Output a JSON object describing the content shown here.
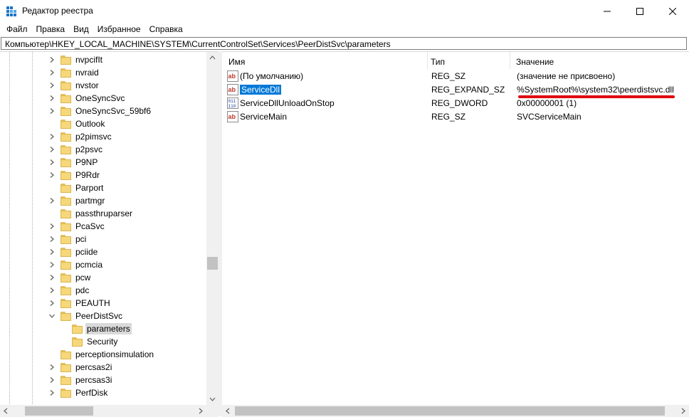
{
  "window": {
    "title": "Редактор реестра",
    "icon": "regedit-icon",
    "controls": [
      "minimize",
      "maximize",
      "close"
    ]
  },
  "menu": [
    "Файл",
    "Правка",
    "Вид",
    "Избранное",
    "Справка"
  ],
  "address": "Компьютер\\HKEY_LOCAL_MACHINE\\SYSTEM\\CurrentControlSet\\Services\\PeerDistSvc\\parameters",
  "tree": {
    "items": [
      {
        "label": "nvpcifIt",
        "arrow": "right",
        "level": 0
      },
      {
        "label": "nvraid",
        "arrow": "right",
        "level": 0
      },
      {
        "label": "nvstor",
        "arrow": "right",
        "level": 0
      },
      {
        "label": "OneSyncSvc",
        "arrow": "right",
        "level": 0
      },
      {
        "label": "OneSyncSvc_59bf6",
        "arrow": "right",
        "level": 0
      },
      {
        "label": "Outlook",
        "arrow": "none",
        "level": 0
      },
      {
        "label": "p2pimsvc",
        "arrow": "right",
        "level": 0
      },
      {
        "label": "p2psvc",
        "arrow": "right",
        "level": 0
      },
      {
        "label": "P9NP",
        "arrow": "right",
        "level": 0
      },
      {
        "label": "P9Rdr",
        "arrow": "right",
        "level": 0
      },
      {
        "label": "Parport",
        "arrow": "none",
        "level": 0
      },
      {
        "label": "partmgr",
        "arrow": "right",
        "level": 0
      },
      {
        "label": "passthruparser",
        "arrow": "none",
        "level": 0
      },
      {
        "label": "PcaSvc",
        "arrow": "right",
        "level": 0
      },
      {
        "label": "pci",
        "arrow": "right",
        "level": 0
      },
      {
        "label": "pciide",
        "arrow": "right",
        "level": 0
      },
      {
        "label": "pcmcia",
        "arrow": "right",
        "level": 0
      },
      {
        "label": "pcw",
        "arrow": "right",
        "level": 0
      },
      {
        "label": "pdc",
        "arrow": "right",
        "level": 0
      },
      {
        "label": "PEAUTH",
        "arrow": "right",
        "level": 0
      },
      {
        "label": "PeerDistSvc",
        "arrow": "down",
        "level": 0
      },
      {
        "label": "parameters",
        "arrow": "none",
        "level": 1,
        "selected": true
      },
      {
        "label": "Security",
        "arrow": "none",
        "level": 1
      },
      {
        "label": "perceptionsimulation",
        "arrow": "none",
        "level": 0
      },
      {
        "label": "percsas2i",
        "arrow": "right",
        "level": 0
      },
      {
        "label": "percsas3i",
        "arrow": "right",
        "level": 0
      },
      {
        "label": "PerfDisk",
        "arrow": "right",
        "level": 0
      }
    ]
  },
  "list": {
    "headers": {
      "name": "Имя",
      "type": "Тип",
      "value": "Значение"
    },
    "rows": [
      {
        "name": "(По умолчанию)",
        "type": "REG_SZ",
        "value": "(значение не присвоено)",
        "icon": "string-value-icon"
      },
      {
        "name": "ServiceDll",
        "type": "REG_EXPAND_SZ",
        "value": "%SystemRoot%\\system32\\peerdistsvc.dll",
        "icon": "string-value-icon",
        "selected": true,
        "underlined": true
      },
      {
        "name": "ServiceDllUnloadOnStop",
        "type": "REG_DWORD",
        "value": "0x00000001 (1)",
        "icon": "binary-value-icon"
      },
      {
        "name": "ServiceMain",
        "type": "REG_SZ",
        "value": "SVCServiceMain",
        "icon": "string-value-icon"
      }
    ]
  },
  "colors": {
    "selection": "#0078d7",
    "annotation": "#e0000f",
    "folder": "#f6d77a"
  }
}
